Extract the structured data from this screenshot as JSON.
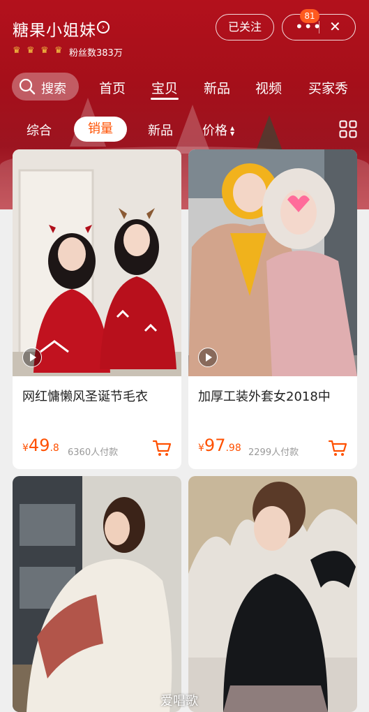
{
  "shop": {
    "name": "糖果小姐妹",
    "fans": "粉丝数383万",
    "crowns": [
      "crown-icon",
      "crown-icon",
      "crown-icon",
      "crown-icon"
    ]
  },
  "header": {
    "follow_label": "已关注",
    "notification_count": "81"
  },
  "search": {
    "label": "搜索"
  },
  "nav_tabs": [
    "首页",
    "宝贝",
    "新品",
    "视频",
    "买家秀"
  ],
  "active_tab": "宝贝",
  "filters": [
    "综合",
    "销量",
    "新品",
    "价格"
  ],
  "active_filter": "销量",
  "products": [
    {
      "title": "网红慵懒风圣诞节毛衣",
      "currency": "¥",
      "price_int": "49",
      "price_dec": ".8",
      "paid": "6360人付款",
      "has_video": true
    },
    {
      "title": "加厚工装外套女2018中",
      "currency": "¥",
      "price_int": "97",
      "price_dec": ".98",
      "paid": "2299人付款",
      "has_video": true
    },
    {
      "title": "",
      "has_video": false
    },
    {
      "title": "",
      "has_video": false
    }
  ],
  "watermark": "爱唱歌",
  "colors": {
    "accent": "#ff5000",
    "header_red": "#b3111c",
    "badge": "#ff5a1f"
  }
}
